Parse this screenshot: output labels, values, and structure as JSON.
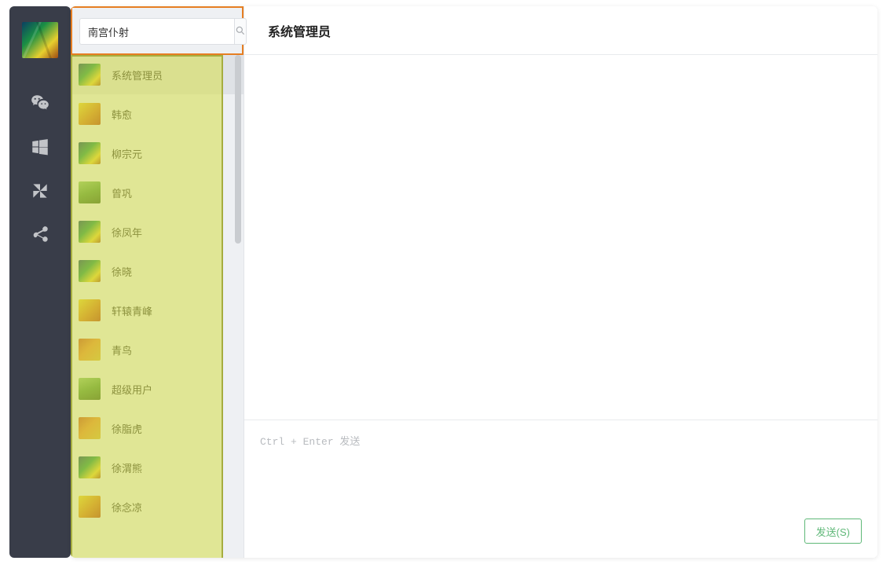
{
  "nav": {
    "icons": [
      "wechat",
      "windows",
      "pinwheel",
      "share"
    ]
  },
  "search": {
    "value": "南宫仆射"
  },
  "contacts": [
    {
      "name": "系统管理员",
      "avatar": "a1",
      "selected": true
    },
    {
      "name": "韩愈",
      "avatar": "a2",
      "selected": false
    },
    {
      "name": "柳宗元",
      "avatar": "a1",
      "selected": false
    },
    {
      "name": "曾巩",
      "avatar": "a3",
      "selected": false
    },
    {
      "name": "徐凤年",
      "avatar": "a1",
      "selected": false
    },
    {
      "name": "徐晓",
      "avatar": "a1",
      "selected": false
    },
    {
      "name": "轩辕青峰",
      "avatar": "a2",
      "selected": false
    },
    {
      "name": "青鸟",
      "avatar": "a4",
      "selected": false
    },
    {
      "name": "超级用户",
      "avatar": "a3",
      "selected": false
    },
    {
      "name": "徐脂虎",
      "avatar": "a4",
      "selected": false
    },
    {
      "name": "徐渭熊",
      "avatar": "a1",
      "selected": false
    },
    {
      "name": "徐念凉",
      "avatar": "a2",
      "selected": false
    }
  ],
  "chat": {
    "title": "系统管理员",
    "compose_hint": "Ctrl + Enter 发送",
    "send_label": "发送(S)"
  }
}
